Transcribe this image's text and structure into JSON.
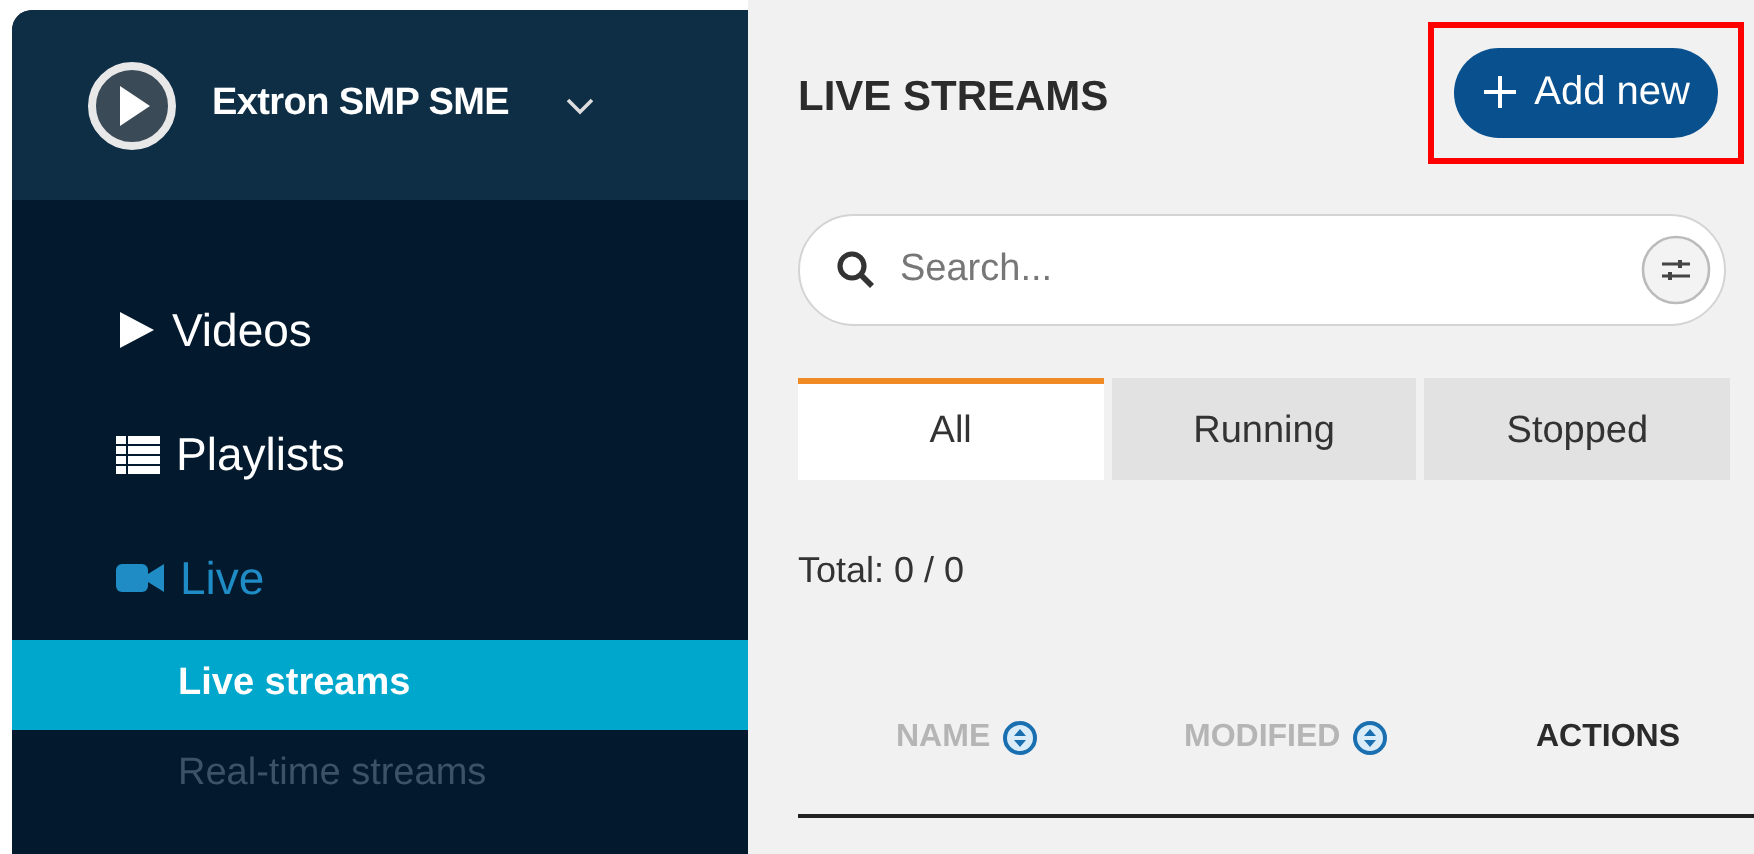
{
  "sidebar": {
    "app_title": "Extron SMP SME",
    "expanded": false,
    "items": [
      {
        "kind": "play",
        "label": "Videos",
        "selected": false
      },
      {
        "kind": "list",
        "label": "Playlists",
        "selected": false
      },
      {
        "kind": "camera",
        "label": "Live",
        "selected": true,
        "children": [
          {
            "label": "Live streams",
            "selected": true,
            "disabled": false
          },
          {
            "label": "Real-time streams",
            "selected": false,
            "disabled": true
          }
        ]
      }
    ]
  },
  "main": {
    "title": "LIVE STREAMS",
    "add_button": {
      "label": "Add new",
      "highlighted": true
    },
    "search": {
      "placeholder": "Search..."
    },
    "tabs": [
      {
        "label": "All",
        "selected": true
      },
      {
        "label": "Running",
        "selected": false
      },
      {
        "label": "Stopped",
        "selected": false
      }
    ],
    "total": "Total: 0 / 0",
    "columns": [
      {
        "label": "NAME",
        "sortable": true
      },
      {
        "label": "MODIFIED",
        "sortable": true
      },
      {
        "label": "ACTIONS",
        "sortable": false
      }
    ]
  }
}
